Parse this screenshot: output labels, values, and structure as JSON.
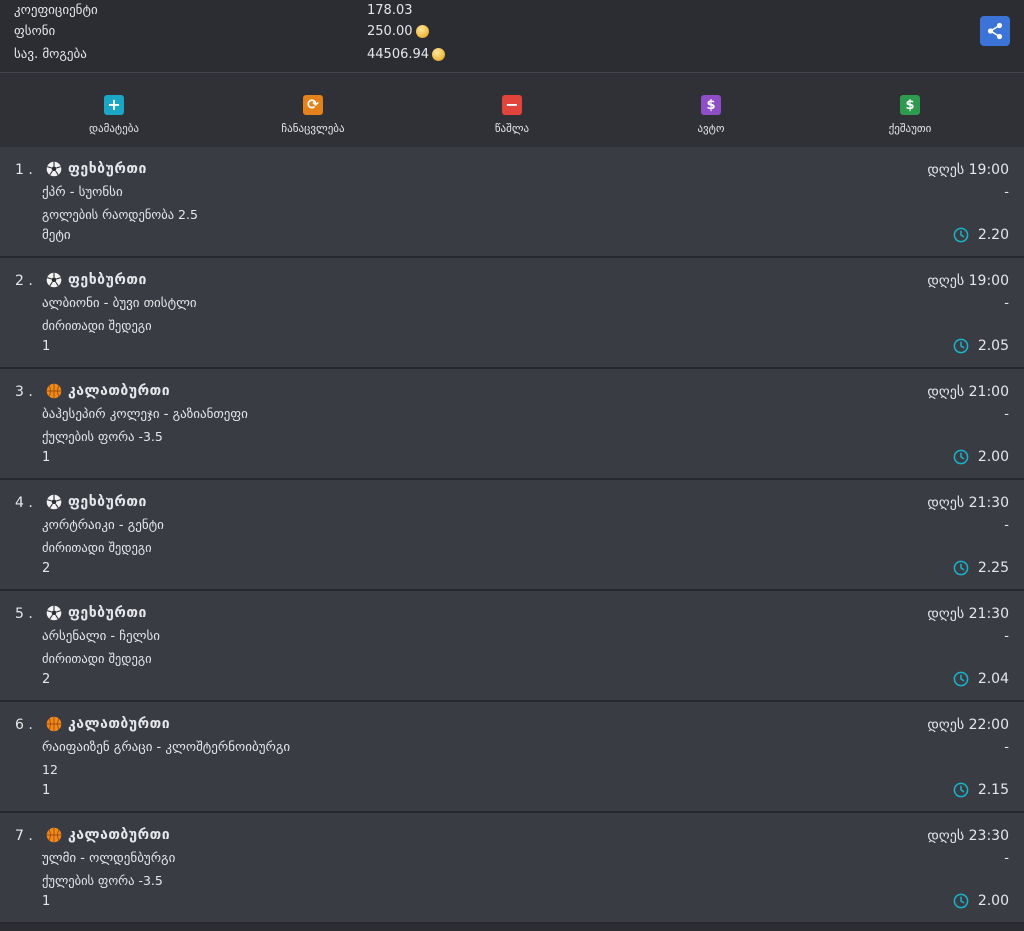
{
  "summary": {
    "odds_label": "კოეფიციენტი",
    "odds_value": "178.03",
    "stake_label": "ფსონი",
    "stake_value": "250.00",
    "win_label": "სავ. მოგება",
    "win_value": "44506.94"
  },
  "actions": [
    {
      "label": "დამატება",
      "icon": "plus-icon",
      "color": "#1aa6c4",
      "glyph": "+"
    },
    {
      "label": "ჩანაცვლება",
      "icon": "refresh-icon",
      "color": "#e3821a",
      "glyph": "⟳"
    },
    {
      "label": "წაშლა",
      "icon": "minus-icon",
      "color": "#e0443a",
      "glyph": "−"
    },
    {
      "label": "ავტო",
      "icon": "dollar-icon",
      "color": "#8e4ec6",
      "glyph": "$"
    },
    {
      "label": "ქეშაუთი",
      "icon": "dollar-icon",
      "color": "#2e9a4e",
      "glyph": "$"
    }
  ],
  "colors": {
    "accent_clock": "#19b4c9",
    "share_button": "#3b73d6"
  },
  "bets": [
    {
      "index": "1 .",
      "sport": "ფეხბურთი",
      "sport_icon": "soccer-ball-icon",
      "match": "ქპრ - სუონსი",
      "market": "გოლების რაოდენობა 2.5",
      "pick": "მეტი",
      "time": "დღეს 19:00",
      "dash": "-",
      "odds": "2.20"
    },
    {
      "index": "2 .",
      "sport": "ფეხბურთი",
      "sport_icon": "soccer-ball-icon",
      "match": "ალბიონი - ბუვი თისტლი",
      "market": "ძირითადი შედეგი",
      "pick": "1",
      "time": "დღეს 19:00",
      "dash": "-",
      "odds": "2.05"
    },
    {
      "index": "3 .",
      "sport": "კალათბურთი",
      "sport_icon": "basketball-icon",
      "match": "ბაჰესეპირ კოლეჯი - გაზიანთეფი",
      "market": "ქულების ფორა -3.5",
      "pick": "1",
      "time": "დღეს 21:00",
      "dash": "-",
      "odds": "2.00"
    },
    {
      "index": "4 .",
      "sport": "ფეხბურთი",
      "sport_icon": "soccer-ball-icon",
      "match": "კორტრაიკი - გენტი",
      "market": "ძირითადი შედეგი",
      "pick": "2",
      "time": "დღეს 21:30",
      "dash": "-",
      "odds": "2.25"
    },
    {
      "index": "5 .",
      "sport": "ფეხბურთი",
      "sport_icon": "soccer-ball-icon",
      "match": "არსენალი - ჩელსი",
      "market": "ძირითადი შედეგი",
      "pick": "2",
      "time": "დღეს 21:30",
      "dash": "-",
      "odds": "2.04"
    },
    {
      "index": "6 .",
      "sport": "კალათბურთი",
      "sport_icon": "basketball-icon",
      "match": "რაიფაიზენ გრაცი - კლოშტერნოიბურგი",
      "market": "12",
      "pick": "1",
      "time": "დღეს 22:00",
      "dash": "-",
      "odds": "2.15"
    },
    {
      "index": "7 .",
      "sport": "კალათბურთი",
      "sport_icon": "basketball-icon",
      "match": "ულმი - ოლდენბურგი",
      "market": "ქულების ფორა -3.5",
      "pick": "1",
      "time": "დღეს 23:30",
      "dash": "-",
      "odds": "2.00"
    }
  ]
}
